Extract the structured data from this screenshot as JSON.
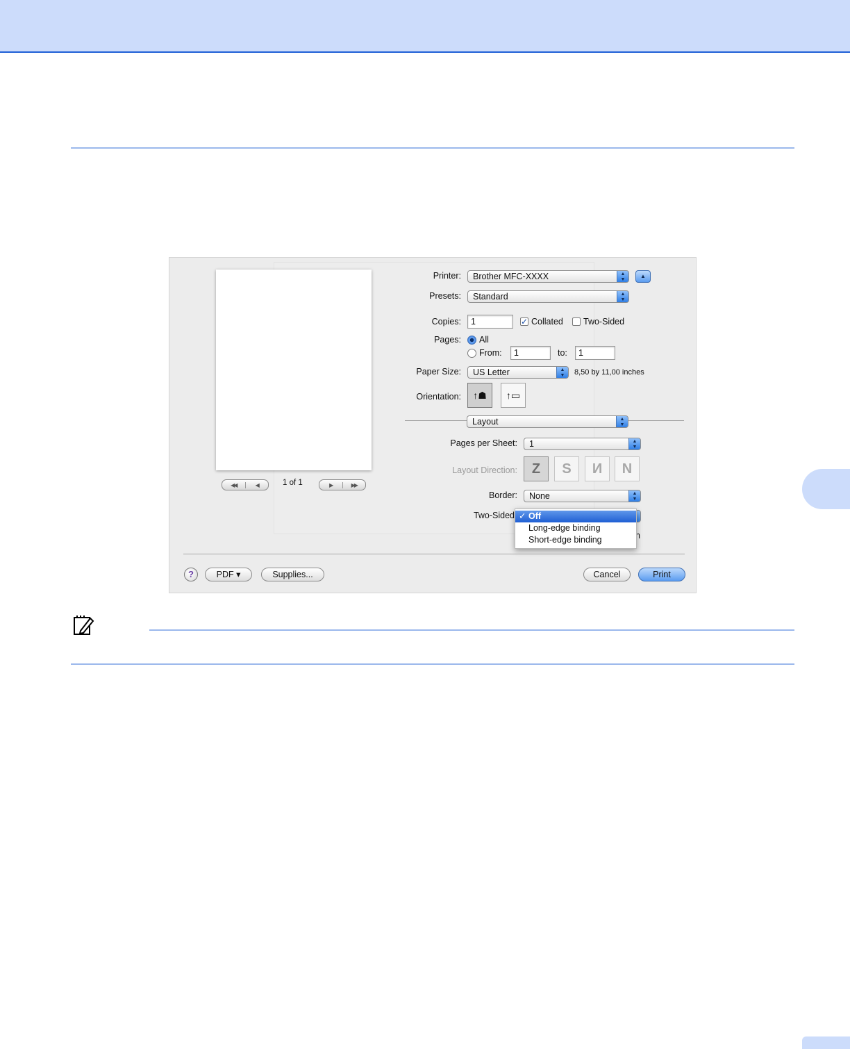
{
  "dialog": {
    "printer": {
      "label": "Printer:",
      "value": "Brother MFC-XXXX"
    },
    "presets": {
      "label": "Presets:",
      "value": "Standard"
    },
    "copies": {
      "label": "Copies:",
      "value": "1",
      "collated_label": "Collated",
      "collated_checked": true,
      "two_sided_label": "Two-Sided",
      "two_sided_checked": false
    },
    "pages": {
      "label": "Pages:",
      "all_label": "All",
      "from_label": "From:",
      "from_value": "1",
      "to_label": "to:",
      "to_value": "1"
    },
    "paper_size": {
      "label": "Paper Size:",
      "value": "US Letter",
      "dimensions": "8,50 by 11,00 inches"
    },
    "orientation": {
      "label": "Orientation:"
    },
    "section": {
      "value": "Layout"
    },
    "pages_per_sheet": {
      "label": "Pages per Sheet:",
      "value": "1"
    },
    "layout_direction": {
      "label": "Layout Direction:"
    },
    "border": {
      "label": "Border:",
      "value": "None"
    },
    "two_sided_popup": {
      "label": "Two-Sided",
      "options": [
        "Off",
        "Long-edge binding",
        "Short-edge binding"
      ],
      "selected": "Off",
      "obscured_tail": "n"
    },
    "preview": {
      "page_indicator": "1 of 1"
    },
    "buttons": {
      "help": "?",
      "pdf": "PDF ▾",
      "supplies": "Supplies...",
      "cancel": "Cancel",
      "print": "Print"
    }
  },
  "colors": {
    "header_band": "#ccdcfb",
    "rule": "#9bb8ec",
    "accent_blue": "#1f5fd4"
  }
}
